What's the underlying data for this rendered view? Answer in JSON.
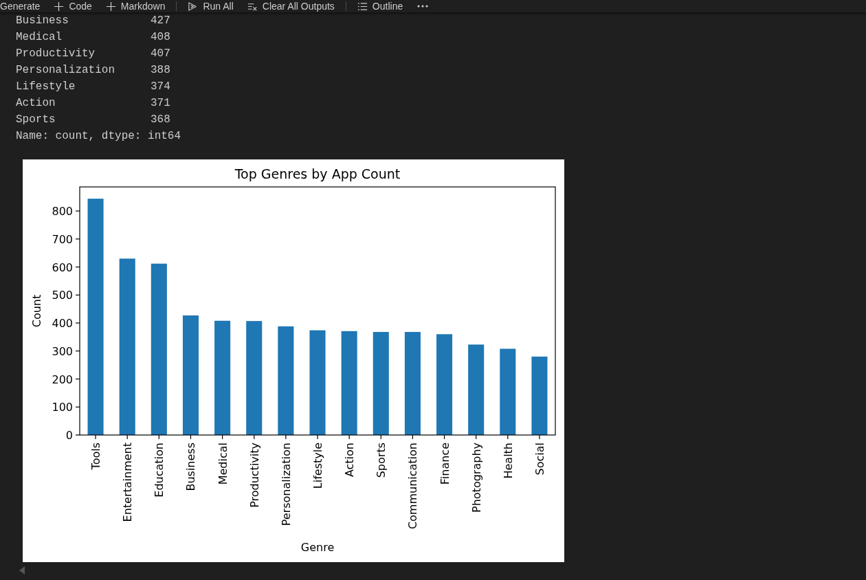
{
  "toolbar": {
    "groups": [
      {
        "items": [
          {
            "kind": "text",
            "label": "Generate"
          },
          {
            "kind": "add",
            "label": "Code"
          },
          {
            "kind": "add",
            "label": "Markdown"
          }
        ]
      },
      {
        "items": [
          {
            "kind": "run",
            "label": "Run All"
          },
          {
            "kind": "clear",
            "label": "Clear All Outputs"
          }
        ]
      },
      {
        "items": [
          {
            "kind": "outline",
            "label": "Outline"
          },
          {
            "kind": "more"
          }
        ]
      }
    ]
  },
  "output": {
    "rows": [
      {
        "name": "Business",
        "count": "427"
      },
      {
        "name": "Medical",
        "count": "408"
      },
      {
        "name": "Productivity",
        "count": "407"
      },
      {
        "name": "Personalization",
        "count": "388"
      },
      {
        "name": "Lifestyle",
        "count": "374"
      },
      {
        "name": "Action",
        "count": "371"
      },
      {
        "name": "Sports",
        "count": "368"
      }
    ],
    "footer": "Name: count, dtype: int64"
  },
  "chart": {
    "chart_data": {
      "type": "bar",
      "title": "Top Genres by App Count",
      "xlabel": "Genre",
      "ylabel": "Count",
      "categories": [
        "Tools",
        "Entertainment",
        "Education",
        "Business",
        "Medical",
        "Productivity",
        "Personalization",
        "Lifestyle",
        "Action",
        "Sports",
        "Communication",
        "Finance",
        "Photography",
        "Health",
        "Social"
      ],
      "values": [
        844,
        630,
        612,
        427,
        408,
        407,
        388,
        374,
        371,
        368,
        368,
        360,
        323,
        308,
        280
      ],
      "ylim": [
        0,
        886
      ],
      "yticks": [
        0,
        100,
        200,
        300,
        400,
        500,
        600,
        700,
        800
      ]
    }
  }
}
